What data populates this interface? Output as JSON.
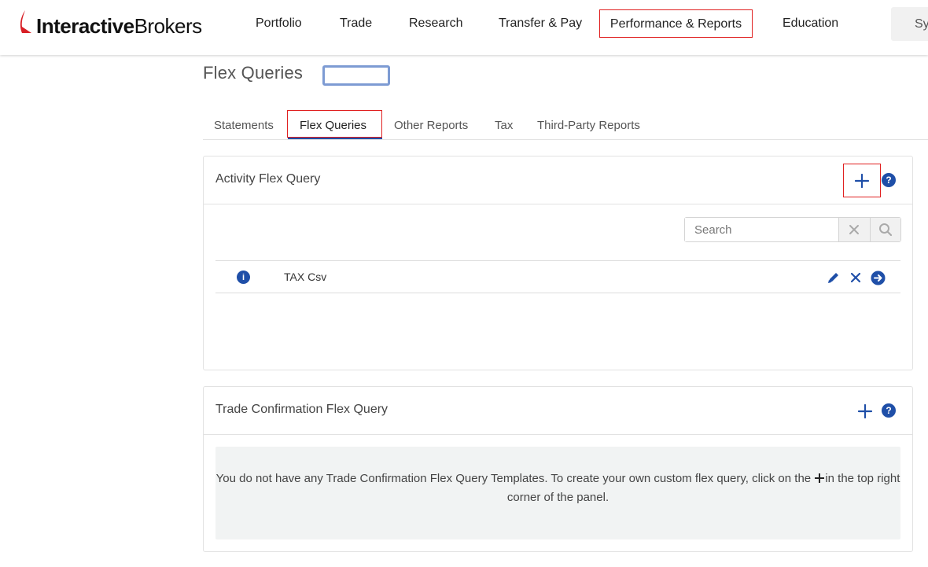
{
  "brand": {
    "part1": "Interactive",
    "part2": "Brokers",
    "accent": "#d81f26"
  },
  "nav": [
    {
      "label": "Portfolio"
    },
    {
      "label": "Trade"
    },
    {
      "label": "Research"
    },
    {
      "label": "Transfer & Pay"
    },
    {
      "label": "Performance & Reports"
    },
    {
      "label": "Education"
    }
  ],
  "header_search": {
    "label": "Sy"
  },
  "page": {
    "title": "Flex Queries"
  },
  "tabs": [
    {
      "label": "Statements"
    },
    {
      "label": "Flex Queries"
    },
    {
      "label": "Other Reports"
    },
    {
      "label": "Tax"
    },
    {
      "label": "Third-Party Reports"
    }
  ],
  "activity_panel": {
    "title": "Activity Flex Query",
    "search_placeholder": "Search",
    "rows": [
      {
        "name": "TAX Csv"
      }
    ]
  },
  "trade_panel": {
    "title": "Trade Confirmation Flex Query",
    "empty_message_before": "You do not have any Trade Confirmation Flex Query Templates. To create your own custom flex query, click on the",
    "empty_message_after": "in the top right corner of the panel."
  },
  "colors": {
    "primary": "#1f4fa8",
    "highlight": "#e02020"
  },
  "icons": [
    "plus-icon",
    "help-icon",
    "clear-icon",
    "search-icon",
    "info-icon",
    "edit-icon",
    "delete-icon",
    "run-icon"
  ]
}
